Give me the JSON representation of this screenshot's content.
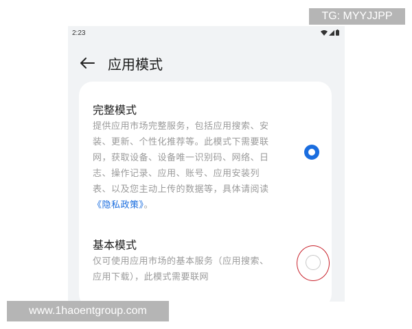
{
  "status_bar": {
    "time": "2:23",
    "icons": [
      "wifi-icon",
      "signal-icon",
      "battery-icon"
    ]
  },
  "header": {
    "back_icon": "arrow-left-icon",
    "title": "应用模式"
  },
  "options": [
    {
      "title": "完整模式",
      "description": "提供应用市场完整服务，包括应用搜索、安装、更新、个性化推荐等。此模式下需要联网，获取设备、设备唯一识别码、网络、日志、操作记录、应用、账号、应用安装列表、以及您主动上传的数据等，具体请阅读",
      "link_text": "《隐私政策》",
      "desc_suffix": "。",
      "selected": true
    },
    {
      "title": "基本模式",
      "description": "仅可使用应用市场的基本服务（应用搜索、应用下载），此模式需要联网",
      "selected": false
    }
  ],
  "watermarks": {
    "top_right": "TG: MYYJJPP",
    "bottom_left": "www.1haoentgroup.com"
  },
  "colors": {
    "accent": "#1a6ddf",
    "annotation_circle": "#c8202a",
    "watermark_bg": "#b5b5b5"
  }
}
